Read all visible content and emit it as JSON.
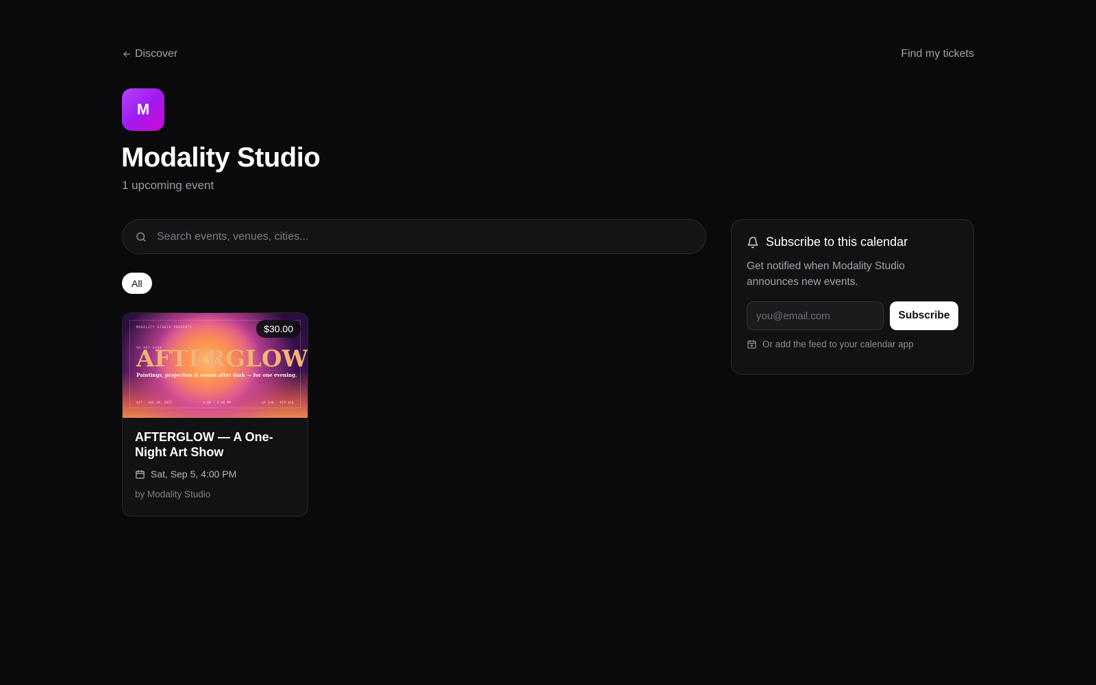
{
  "nav": {
    "back_label": "Discover",
    "find_tickets_label": "Find my tickets"
  },
  "organizer": {
    "logo_letter": "M",
    "name": "Modality Studio",
    "upcoming_count_text": "1 upcoming event",
    "logo_gradient": [
      "#b545ff",
      "#d10ad6"
    ]
  },
  "search": {
    "placeholder": "Search events, venues, cities...",
    "value": "",
    "icon": "search-icon"
  },
  "filters": [
    {
      "label": "All",
      "selected": true
    }
  ],
  "events": [
    {
      "price": "$30.00",
      "title": "AFTERGLOW — A One-Night Art Show",
      "date": "Sat, Sep 5, 4:00 PM",
      "host": "by Modality Studio",
      "poster": {
        "kicker": "MODALITY STUDIO PRESENTS",
        "kicker2": "AN ART SHOW",
        "title": "AFTERGLOW",
        "tagline": "Paintings, projection & sound after dark — for one evening.",
        "footer_left": "SAT · AUG 29, 2025",
        "footer_center": "4:00 – 5:00 PM",
        "footer_right": "GA $30 · VIP $50"
      }
    }
  ],
  "subscribe": {
    "title": "Subscribe to this calendar",
    "description": "Get notified when Modality Studio announces new events.",
    "email_placeholder": "you@email.com",
    "button_label": "Subscribe",
    "feed_text": "Or add the feed to your calendar app"
  },
  "colors": {
    "background": "#0a0a0c",
    "card": "#121214",
    "accent": "#b545ff",
    "text_muted": "#a1a1aa"
  }
}
